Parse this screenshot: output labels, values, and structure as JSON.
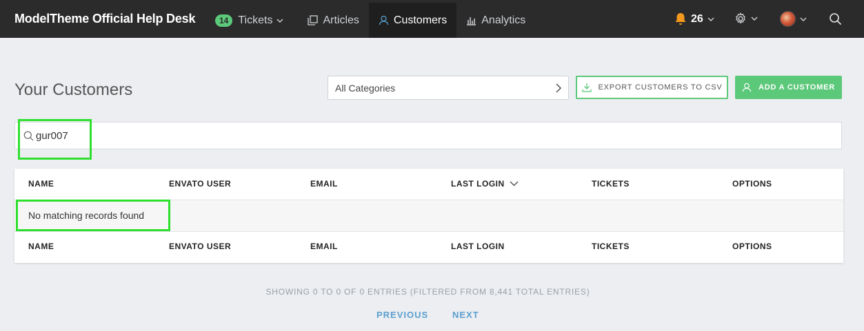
{
  "topbar": {
    "brand": "ModelTheme Official Help Desk",
    "nav": [
      {
        "label": "Tickets",
        "badge": "14"
      },
      {
        "label": "Articles"
      },
      {
        "label": "Customers"
      },
      {
        "label": "Analytics"
      }
    ],
    "notifications_count": "26"
  },
  "page": {
    "title": "Your Customers",
    "category_select": "All Categories",
    "export_label": "EXPORT CUSTOMERS TO CSV",
    "add_label": "ADD A CUSTOMER"
  },
  "search": {
    "value": "gur007"
  },
  "table": {
    "columns": [
      "NAME",
      "ENVATO USER",
      "EMAIL",
      "LAST LOGIN",
      "TICKETS",
      "OPTIONS"
    ],
    "empty_message": "No matching records found"
  },
  "pagination": {
    "info": "SHOWING 0 TO 0 OF 0 ENTRIES (FILTERED FROM 8,441 TOTAL ENTRIES)",
    "previous": "PREVIOUS",
    "next": "NEXT"
  },
  "colors": {
    "accent": "#5cc87a",
    "highlight": "#2ee02e",
    "link": "#5a9fd0"
  }
}
